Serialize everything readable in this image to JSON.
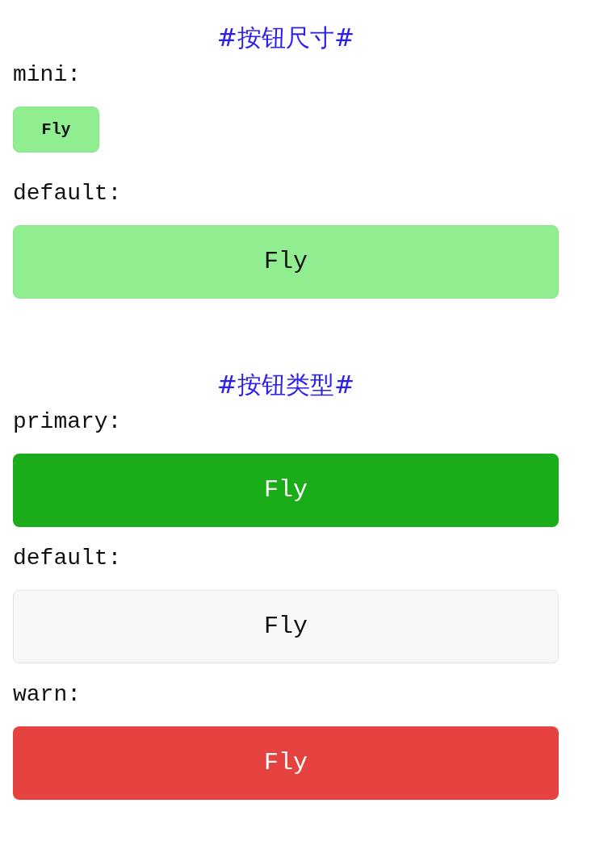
{
  "sections": [
    {
      "title": "#按钮尺寸#",
      "items": [
        {
          "label": "mini:",
          "kind": "mini",
          "button": "Fly"
        },
        {
          "label": "default:",
          "kind": "large",
          "button": "Fly"
        }
      ]
    },
    {
      "title": "#按钮类型#",
      "items": [
        {
          "label": "primary:",
          "kind": "green",
          "button": "Fly"
        },
        {
          "label": "default:",
          "kind": "plain",
          "button": "Fly"
        },
        {
          "label": "warn:",
          "kind": "red",
          "button": "Fly"
        }
      ]
    }
  ]
}
